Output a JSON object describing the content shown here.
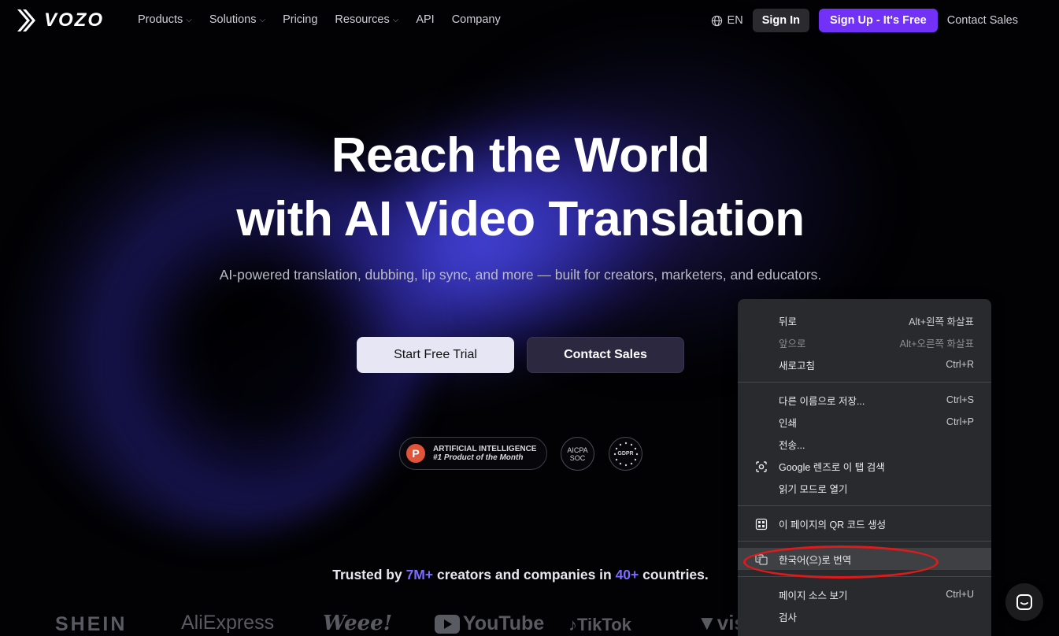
{
  "nav": {
    "logo_text": "VOZO",
    "menu": [
      {
        "label": "Products",
        "has_dropdown": true
      },
      {
        "label": "Solutions",
        "has_dropdown": true
      },
      {
        "label": "Pricing",
        "has_dropdown": false
      },
      {
        "label": "Resources",
        "has_dropdown": true
      },
      {
        "label": "API",
        "has_dropdown": false
      },
      {
        "label": "Company",
        "has_dropdown": false
      }
    ],
    "language": "EN",
    "sign_in": "Sign In",
    "sign_up": "Sign Up - It's Free",
    "contact_sales": "Contact Sales"
  },
  "hero": {
    "title_line1": "Reach the World",
    "title_line2": "with AI Video Translation",
    "subtitle": "AI-powered translation, dubbing, lip sync, and more — built for creators, marketers, and educators.",
    "cta_primary": "Start Free Trial",
    "cta_secondary": "Contact Sales"
  },
  "badges": {
    "product_hunt": {
      "letter": "P",
      "line1": "ARTIFICIAL INTELLIGENCE",
      "line2": "#1 Product of the Month"
    },
    "aicpa": {
      "line1": "AICPA",
      "line2": "SOC"
    },
    "gdpr": "GDPR"
  },
  "trusted": {
    "prefix": "Trusted by ",
    "users": "7M+",
    "middle": " creators and companies in ",
    "countries": "40+",
    "suffix": " countries."
  },
  "brands": [
    "SHEIN",
    "AliExpress",
    "Weee!",
    "YouTube",
    "TikTok",
    "vis"
  ],
  "context_menu": {
    "group1": [
      {
        "label": "뒤로",
        "shortcut": "Alt+왼쪽 화살표",
        "disabled": false
      },
      {
        "label": "앞으로",
        "shortcut": "Alt+오른쪽 화살표",
        "disabled": true
      },
      {
        "label": "새로고침",
        "shortcut": "Ctrl+R",
        "disabled": false
      }
    ],
    "group2": [
      {
        "label": "다른 이름으로 저장...",
        "shortcut": "Ctrl+S"
      },
      {
        "label": "인쇄",
        "shortcut": "Ctrl+P"
      },
      {
        "label": "전송...",
        "shortcut": ""
      },
      {
        "label": "Google 렌즈로 이 탭 검색",
        "shortcut": "",
        "icon": "lens-icon"
      },
      {
        "label": "읽기 모드로 열기",
        "shortcut": ""
      }
    ],
    "group3": [
      {
        "label": "이 페이지의 QR 코드 생성",
        "shortcut": "",
        "icon": "qr-code-icon"
      }
    ],
    "group4": [
      {
        "label": "한국어(으)로 번역",
        "shortcut": "",
        "icon": "translate-icon",
        "highlighted": true
      }
    ],
    "group5": [
      {
        "label": "페이지 소스 보기",
        "shortcut": "Ctrl+U"
      },
      {
        "label": "검사",
        "shortcut": ""
      }
    ]
  },
  "colors": {
    "accent": "#7131f6",
    "highlight_text": "#7b6cff",
    "annotation": "#e01a1a"
  }
}
